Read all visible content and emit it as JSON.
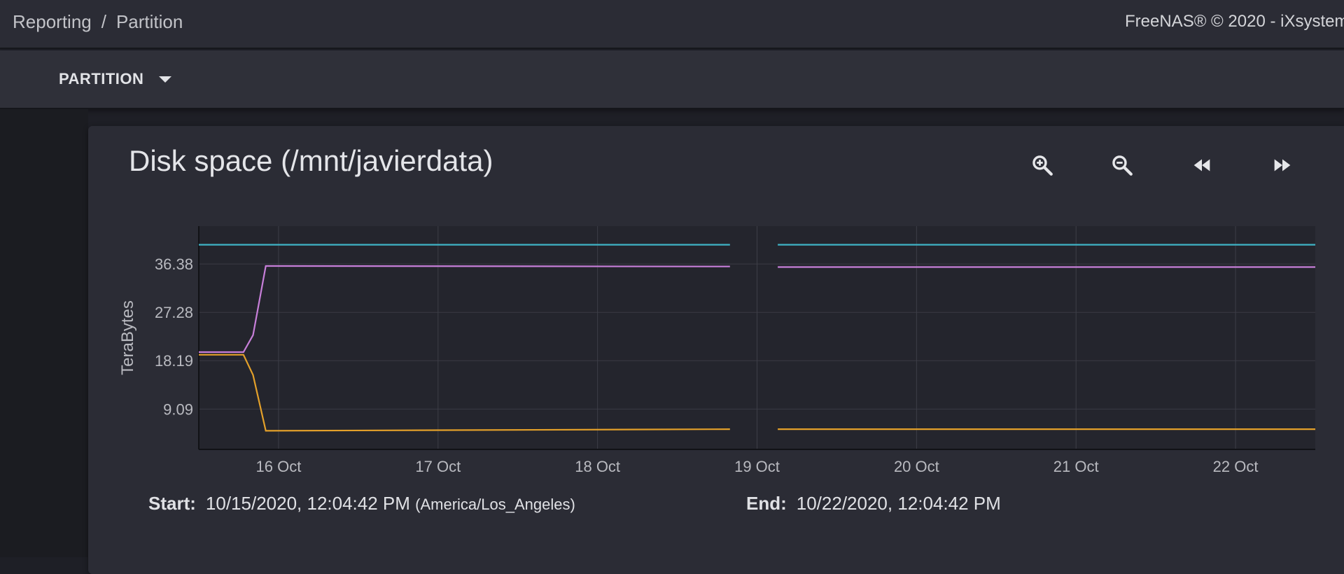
{
  "breadcrumb": {
    "root": "Reporting",
    "separator": "/",
    "current": "Partition"
  },
  "copyright": "FreeNAS® © 2020 - iXsystem",
  "toolbar": {
    "selector_label": "PARTITION",
    "selector_icon": "caret-down-icon"
  },
  "card": {
    "title": "Disk space (/mnt/javierdata)",
    "controls": [
      "zoom-in-icon",
      "zoom-out-icon",
      "rewind-icon",
      "fast-forward-icon"
    ]
  },
  "footer": {
    "start_label": "Start:",
    "start_value": "10/15/2020, 12:04:42 PM",
    "timezone": "(America/Los_Angeles)",
    "end_label": "End:",
    "end_value": "10/22/2020, 12:04:42 PM"
  },
  "colors": {
    "cyan": "#3fb4c6",
    "purple": "#c77fd9",
    "orange": "#e3a02a"
  },
  "chart_data": {
    "type": "line",
    "ylabel": "TeraBytes",
    "y_ticks": [
      9.09,
      18.19,
      27.28,
      36.38
    ],
    "x_ticks": [
      "16 Oct",
      "17 Oct",
      "18 Oct",
      "19 Oct",
      "20 Oct",
      "21 Oct",
      "22 Oct"
    ],
    "x_range_days": [
      15.5,
      22.5
    ],
    "ylim": [
      1.5,
      43.5
    ],
    "gap": [
      18.83,
      19.13
    ],
    "grid": true,
    "series": [
      {
        "color": "#3fb4c6",
        "points": [
          [
            15.5,
            40.0
          ],
          [
            18.83,
            40.0
          ],
          [
            19.13,
            40.0
          ],
          [
            22.5,
            40.0
          ]
        ]
      },
      {
        "color": "#c77fd9",
        "points": [
          [
            15.5,
            19.8
          ],
          [
            15.78,
            19.8
          ],
          [
            15.84,
            23.0
          ],
          [
            15.92,
            36.0
          ],
          [
            18.83,
            35.9
          ],
          [
            19.13,
            35.8
          ],
          [
            22.5,
            35.8
          ]
        ]
      },
      {
        "color": "#e3a02a",
        "points": [
          [
            15.5,
            19.3
          ],
          [
            15.78,
            19.3
          ],
          [
            15.84,
            15.5
          ],
          [
            15.92,
            5.0
          ],
          [
            18.83,
            5.3
          ],
          [
            19.13,
            5.3
          ],
          [
            22.5,
            5.3
          ]
        ]
      }
    ]
  }
}
